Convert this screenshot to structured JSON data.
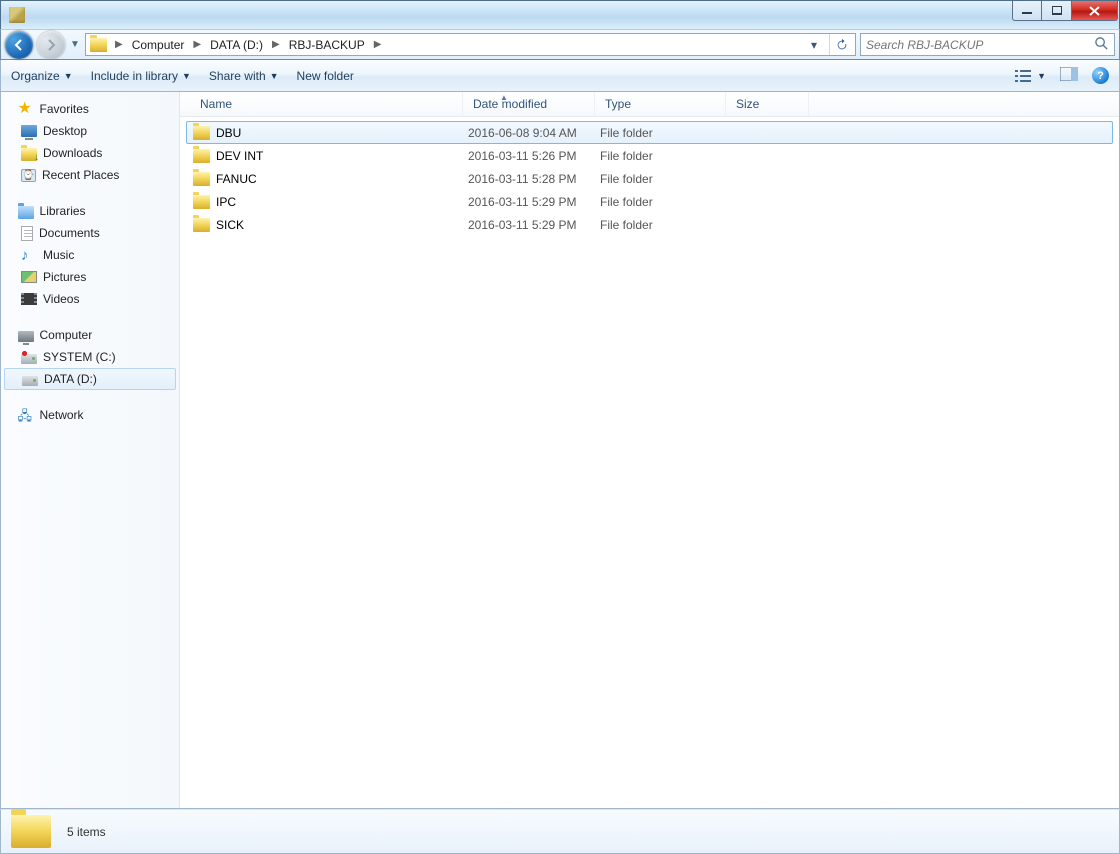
{
  "breadcrumbs": {
    "items": [
      "Computer",
      "DATA (D:)",
      "RBJ-BACKUP"
    ]
  },
  "search": {
    "placeholder": "Search RBJ-BACKUP"
  },
  "toolbar": {
    "organize": "Organize",
    "include": "Include in library",
    "share": "Share with",
    "newfolder": "New folder"
  },
  "columns": {
    "name": "Name",
    "date": "Date modified",
    "type": "Type",
    "size": "Size"
  },
  "sidebar": {
    "favorites": {
      "label": "Favorites"
    },
    "desktop": {
      "label": "Desktop"
    },
    "downloads": {
      "label": "Downloads"
    },
    "recent": {
      "label": "Recent Places"
    },
    "libraries": {
      "label": "Libraries"
    },
    "documents": {
      "label": "Documents"
    },
    "music": {
      "label": "Music"
    },
    "pictures": {
      "label": "Pictures"
    },
    "videos": {
      "label": "Videos"
    },
    "computer": {
      "label": "Computer"
    },
    "system": {
      "label": "SYSTEM (C:)"
    },
    "data": {
      "label": "DATA (D:)"
    },
    "network": {
      "label": "Network"
    }
  },
  "files": [
    {
      "name": "DBU",
      "date": "2016-06-08 9:04 AM",
      "type": "File folder",
      "size": ""
    },
    {
      "name": "DEV INT",
      "date": "2016-03-11 5:26 PM",
      "type": "File folder",
      "size": ""
    },
    {
      "name": "FANUC",
      "date": "2016-03-11 5:28 PM",
      "type": "File folder",
      "size": ""
    },
    {
      "name": "IPC",
      "date": "2016-03-11 5:29 PM",
      "type": "File folder",
      "size": ""
    },
    {
      "name": "SICK",
      "date": "2016-03-11 5:29 PM",
      "type": "File folder",
      "size": ""
    }
  ],
  "status": {
    "text": "5 items"
  }
}
